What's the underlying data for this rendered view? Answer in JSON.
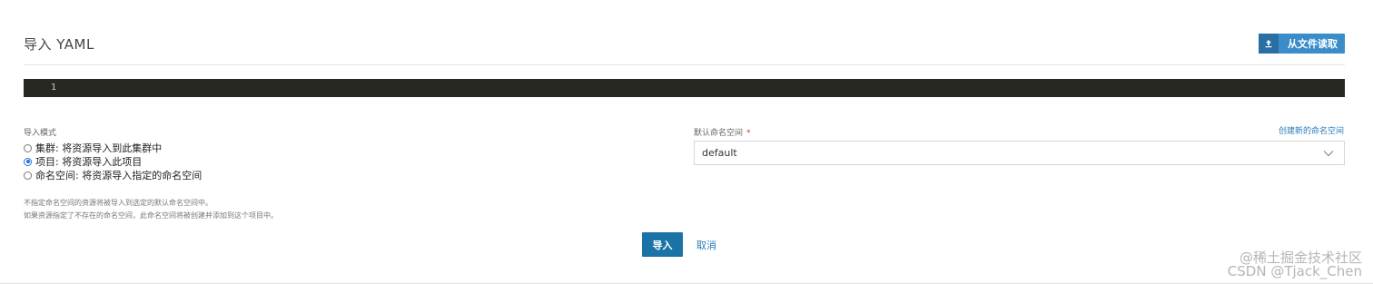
{
  "header": {
    "title": "导入 YAML",
    "read_file_button": "从文件读取",
    "read_file_icon": "upload-icon"
  },
  "editor": {
    "line_number": "1",
    "content": ""
  },
  "import_mode": {
    "label": "导入模式",
    "options": [
      {
        "label": "集群: 将资源导入到此集群中",
        "checked": false
      },
      {
        "label": "项目: 将资源导入此项目",
        "checked": true
      },
      {
        "label": "命名空间: 将资源导入指定的命名空间",
        "checked": false
      }
    ]
  },
  "namespace": {
    "label": "默认命名空间",
    "required_mark": "*",
    "create_link": "创建新的命名空间",
    "selected": "default"
  },
  "hints": [
    "不指定命名空间的资源将被导入到选定的默认命名空间中。",
    "如果资源指定了不存在的命名空间，此命名空间将被创建并添加到这个项目中。"
  ],
  "actions": {
    "import_label": "导入",
    "cancel_label": "取消"
  },
  "watermark": "@稀土掘金技术社区\nCSDN @Tjack_Chen"
}
